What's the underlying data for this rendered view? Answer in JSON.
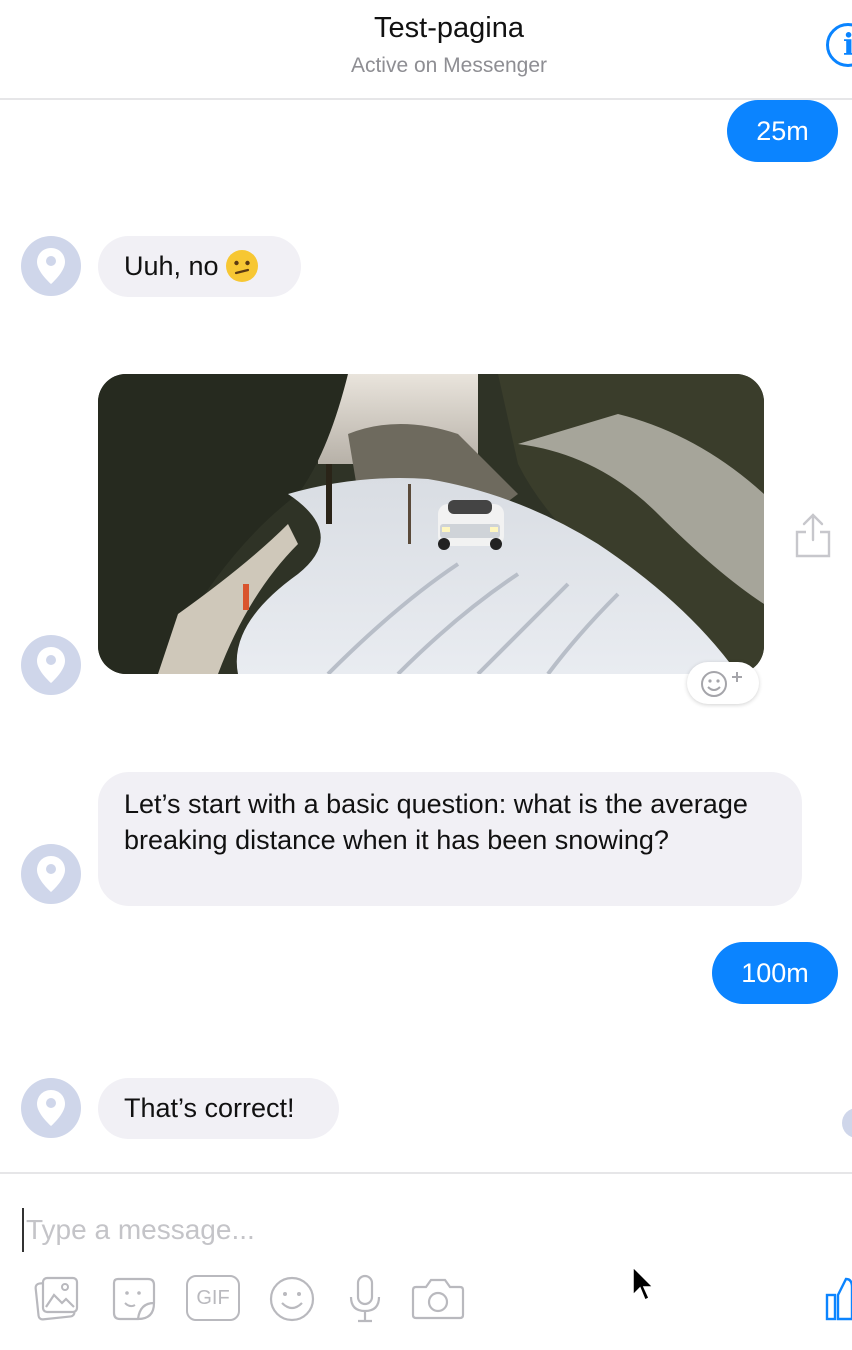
{
  "header": {
    "title": "Test-pagina",
    "subtitle": "Active on Messenger",
    "info_icon": "info-icon"
  },
  "messages": {
    "out_1": "25m",
    "in_1": "Uuh, no",
    "in_1_emoji": "confused-face-emoji",
    "image_alt": "snowy-road-rally-car-gif",
    "in_2": "Let’s start with a basic question: what is the average breaking distance when it has been snowing?",
    "out_2": "100m",
    "in_3": "That’s correct!"
  },
  "composer": {
    "placeholder": "Type a message...",
    "tools": [
      "photo-icon",
      "sticker-icon",
      "gif-icon",
      "emoji-icon",
      "microphone-icon",
      "camera-icon"
    ],
    "gif_label": "GIF"
  },
  "colors": {
    "accent": "#0b84ff",
    "incoming_bubble": "#f1f0f5",
    "avatar": "#cfd6ea"
  }
}
